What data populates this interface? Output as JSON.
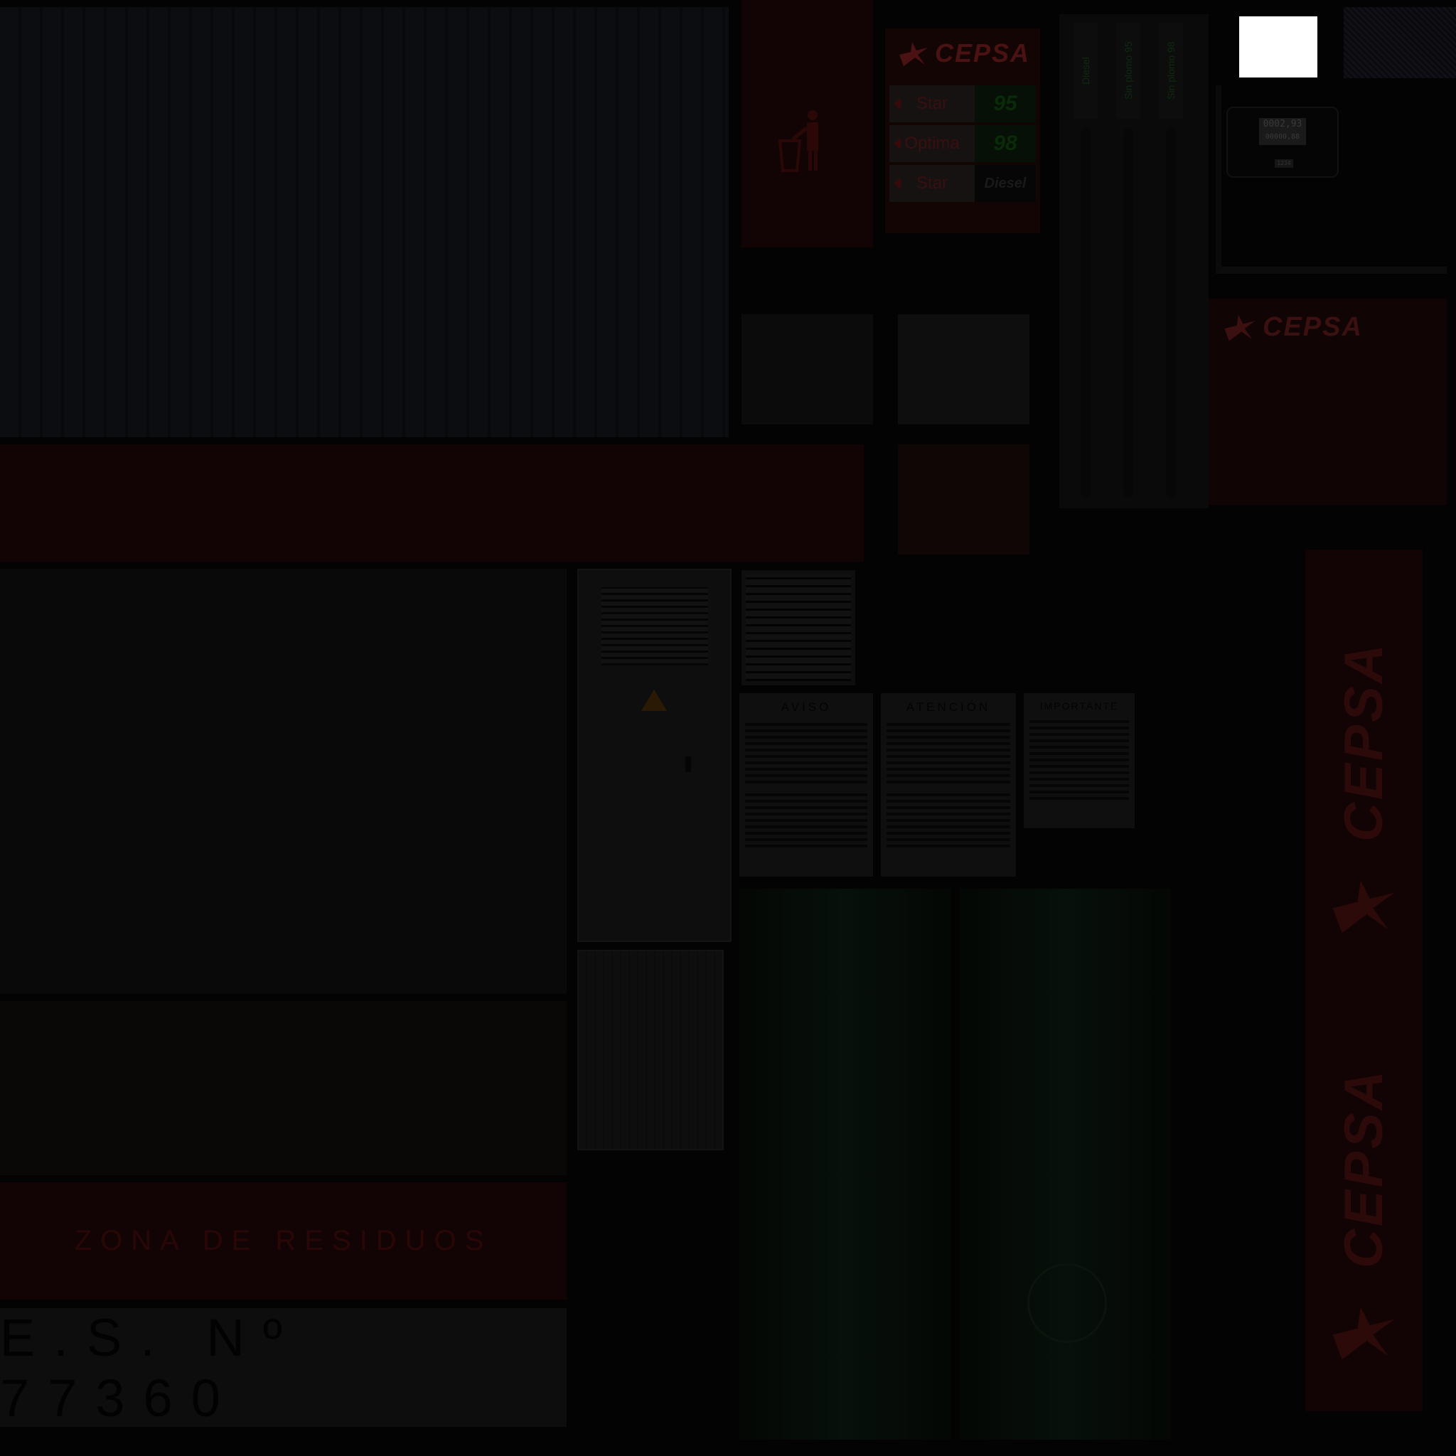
{
  "price_sign": {
    "brand": "CEPSA",
    "rows": [
      {
        "name": "Star",
        "value": "95"
      },
      {
        "name": "Optima",
        "value": "98"
      },
      {
        "name": "Star",
        "value": "Diesel"
      }
    ]
  },
  "pump": {
    "nozzles": [
      "Diesel",
      "Sin plomo 95",
      "Sin plomo 98"
    ]
  },
  "display": {
    "amount": "0002,93",
    "liters": "00000,88",
    "small": "1234"
  },
  "panel_brand": "CEPSA",
  "notices": [
    {
      "title": "AVISO"
    },
    {
      "title": "ATENCIÓN"
    },
    {
      "title": "IMPORTANTE"
    }
  ],
  "zona_label": "ZONA DE RESIDUOS",
  "station_number": "E.S. Nº 77360",
  "vertical_banner": {
    "top": "CEPSA",
    "bottom": "CEPSA"
  }
}
